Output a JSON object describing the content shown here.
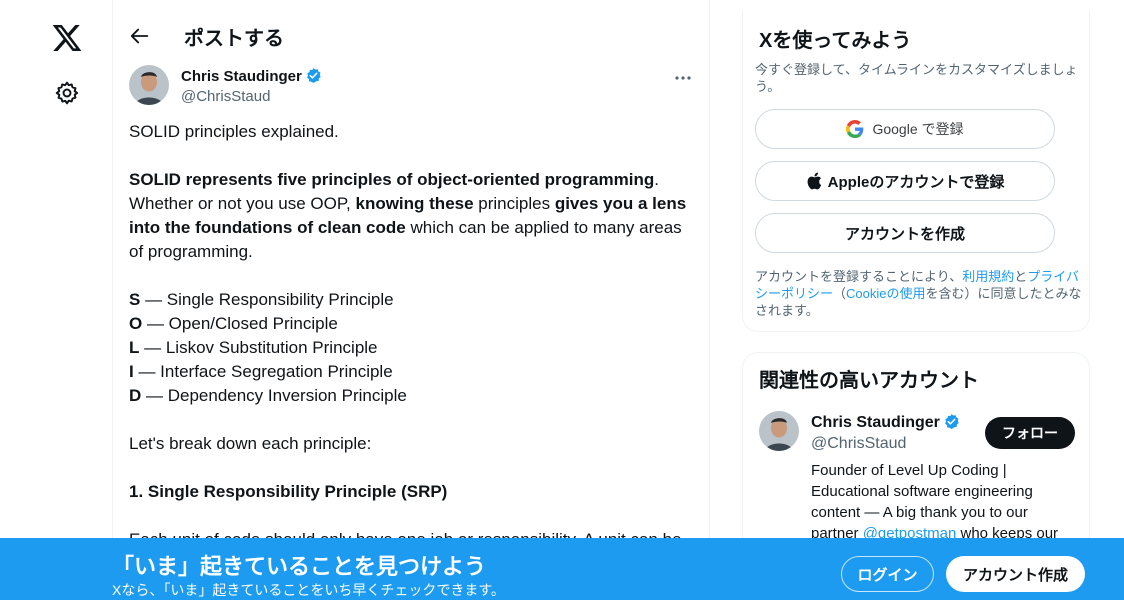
{
  "colors": {
    "accent": "#1d9bf0",
    "text": "#0f1419",
    "muted": "#536471",
    "border": "#eff3f4"
  },
  "nav": {
    "logo_icon": "x-logo-icon",
    "settings_icon": "gear-icon"
  },
  "header": {
    "back_icon": "arrow-left-icon",
    "title": "ポストする"
  },
  "post": {
    "author_name": "Chris Staudinger",
    "author_handle": "@ChrisStaud",
    "verified_icon": "verified-badge-icon",
    "more_icon": "more-horizontal-icon",
    "intro": "SOLID principles explained.",
    "p2": {
      "s1": "SOLID represents five principles of object-oriented programming",
      "s2": ". Whether or not you use OOP, ",
      "s3": "knowing these",
      "s4": " principles ",
      "s5": "gives you a lens into the foundations of clean code",
      "s6": " which can be applied to many areas of programming."
    },
    "principles": [
      {
        "letter": "S",
        "text": " — Single Responsibility Principle"
      },
      {
        "letter": "O",
        "text": " — Open/Closed Principle"
      },
      {
        "letter": "L",
        "text": " — Liskov Substitution Principle"
      },
      {
        "letter": "I",
        "text": " — Interface Segregation Principle"
      },
      {
        "letter": "D",
        "text": " — Dependency Inversion Principle"
      }
    ],
    "breakdown": "Let's break down each principle:",
    "section1_title": "1. Single Responsibility Principle (SRP)",
    "section1_text": "Each unit of code should only have one job or responsibility. A unit can be"
  },
  "signup": {
    "title": "Xを使ってみよう",
    "subtitle": "今すぐ登録して、タイムラインをカスタマイズしましょう。",
    "google_label": "Google で登録",
    "apple_label": "Appleのアカウントで登録",
    "create_label": "アカウントを作成",
    "legal": {
      "t1": "アカウントを登録することにより、",
      "terms": "利用規約",
      "t2": "と",
      "privacy": "プライバシーポリシー",
      "t3": "（",
      "cookie": "Cookieの使用",
      "t4": "を含む）に同意したとみなされます。"
    }
  },
  "related": {
    "title": "関連性の高いアカウント",
    "name": "Chris Staudinger",
    "handle": "@ChrisStaud",
    "follow_label": "フォロー",
    "bio_prefix": "Founder of Level Up Coding | Educational software engineering content — A big thank you to our partner ",
    "bio_mention": "@getpostman",
    "bio_suffix": " who keeps our content free!"
  },
  "banner": {
    "title": "「いま」起きていることを見つけよう",
    "subtitle": "Xなら、「いま」起きていることをいち早くチェックできます。",
    "login_label": "ログイン",
    "create_label": "アカウント作成"
  }
}
